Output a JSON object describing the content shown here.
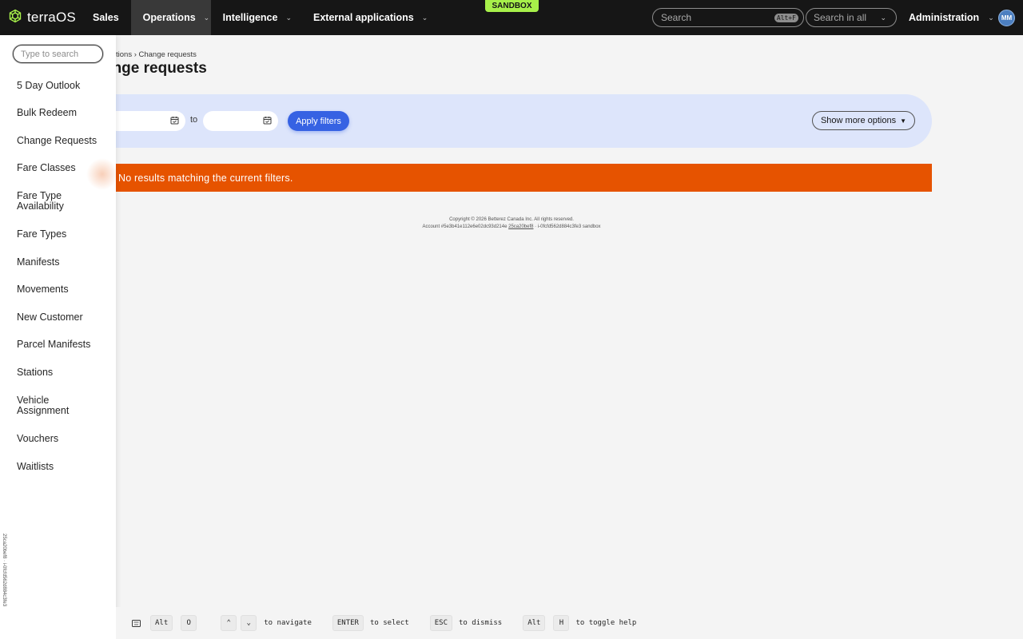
{
  "header": {
    "logo_text": "terraOS",
    "nav": [
      {
        "label": "Sales",
        "has_menu": false
      },
      {
        "label": "Operations",
        "has_menu": true,
        "active": true
      },
      {
        "label": "Intelligence",
        "has_menu": true
      },
      {
        "label": "External applications",
        "has_menu": true
      }
    ],
    "environment_badge": "SANDBOX",
    "search": {
      "placeholder": "Search",
      "shortcut": "Alt+F"
    },
    "search_scope": "Search in all",
    "admin_label": "Administration",
    "avatar_initials": "MM"
  },
  "side_menu": {
    "search_placeholder": "Type to search",
    "items": [
      "5 Day Outlook",
      "Bulk Redeem",
      "Change Requests",
      "Fare Classes",
      "Fare Type Availability",
      "Fare Types",
      "Manifests",
      "Movements",
      "New Customer",
      "Parcel Manifests",
      "Stations",
      "Vehicle Assignment",
      "Vouchers",
      "Waitlists"
    ],
    "vertical_id": "25ca20bef8 · i-0fcfd562d884c3fe3"
  },
  "main": {
    "breadcrumb": "tions › Change requests",
    "title": "ange requests",
    "filters": {
      "from_value": "",
      "to_label": "to",
      "to_value": "",
      "apply_label": "Apply filters",
      "more_options_label": "Show more options"
    },
    "alert": "No results matching the current filters.",
    "footer": {
      "copyright": "Copyright © 2026 Betterez Canada Inc. All rights reserved.",
      "account_prefix": "Account #5e3b41e112e6e02dc93d214e",
      "account_link": "25ca20bef8",
      "account_suffix": "· i-0fcfd562d884c3fe3 sandbox"
    }
  },
  "keyboard_help": {
    "open_keys": [
      "Alt",
      "O"
    ],
    "navigate_keys": [
      "⌃",
      "⌄"
    ],
    "navigate_label": "to navigate",
    "select_key": "ENTER",
    "select_label": "to select",
    "dismiss_key": "ESC",
    "dismiss_label": "to dismiss",
    "help_keys": [
      "Alt",
      "H"
    ],
    "help_label": "to toggle help"
  },
  "colors": {
    "topbar": "#161616",
    "accent_blue": "#3662e3",
    "filter_bg": "#dde5fb",
    "alert_orange": "#e65300",
    "sandbox_green": "#a7f04a"
  }
}
